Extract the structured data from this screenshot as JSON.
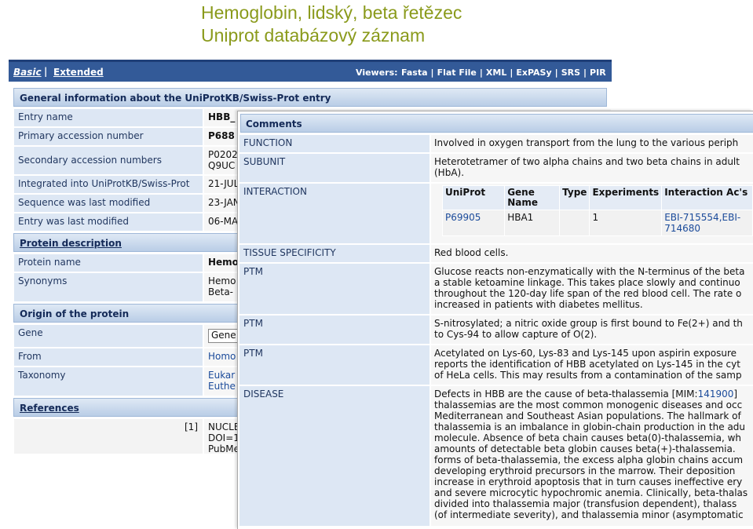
{
  "slide": {
    "title_line1": "Hemoglobin, lidský, beta řetězec",
    "title_line2": "Uniprot databázový záznam"
  },
  "nav": {
    "basic": "Basic",
    "separator": "|",
    "extended": "Extended",
    "viewers_label": "Viewers:",
    "viewers": [
      "Fasta",
      "Flat File",
      "XML",
      "ExPASy",
      "SRS",
      "PIR"
    ]
  },
  "general": {
    "heading": "General information about the UniProtKB/Swiss-Prot entry",
    "rows": [
      {
        "label": "Entry name",
        "value": "HBB_"
      },
      {
        "label": "Primary accession number",
        "value": "P688"
      },
      {
        "label": "Secondary accession numbers",
        "value_line1": "P0202",
        "value_line2": "Q9UC"
      },
      {
        "label": "Integrated into UniProtKB/Swiss-Prot",
        "value": "21-JUL"
      },
      {
        "label": "Sequence was last modified",
        "value": "23-JAN"
      },
      {
        "label": "Entry was last modified",
        "value": "06-MA"
      }
    ]
  },
  "protein": {
    "heading": "Protein description",
    "rows": [
      {
        "label": "Protein name",
        "value": "Hemo"
      },
      {
        "label": "Synonyms",
        "value_line1": "Hemo",
        "value_line2": "Beta-"
      }
    ]
  },
  "origin": {
    "heading": "Origin of the protein",
    "rows": [
      {
        "label": "Gene",
        "value": "Gene"
      },
      {
        "label": "From",
        "value": "Homo"
      },
      {
        "label": "Taxonomy",
        "value_line1": "Eukar",
        "value_line2": "Euthe"
      }
    ]
  },
  "references": {
    "heading": "References",
    "ref_number": "[1]",
    "ref_line1": "NUCLE",
    "ref_line2": "DOI=1",
    "ref_line3": "PubMe"
  },
  "comments": {
    "heading": "Comments",
    "function": {
      "label": "FUNCTION",
      "text": "Involved in oxygen transport from the lung to the various periph"
    },
    "subunit": {
      "label": "SUBUNIT",
      "line1": "Heterotetramer of two alpha chains and two beta chains in adult",
      "line2": "(HbA)."
    },
    "interaction": {
      "label": "INTERACTION",
      "headers": [
        "UniProt",
        "Gene Name",
        "Type",
        "Experiments",
        "Interaction Ac's"
      ],
      "header_gene_line1": "Gene",
      "header_gene_line2": "Name",
      "row": {
        "uniprot": "P69905",
        "gene": "HBA1",
        "type": "",
        "experiments": "1",
        "ac_line1": "EBI-715554,EBI-",
        "ac_line2": "714680"
      }
    },
    "tissue": {
      "label": "TISSUE SPECIFICITY",
      "text": "Red blood cells."
    },
    "ptm1": {
      "label": "PTM",
      "lines": [
        "Glucose reacts non-enzymatically with the N-terminus of the beta",
        "a stable ketoamine linkage. This takes place slowly and continuo",
        "throughout the 120-day life span of the red blood cell. The rate o",
        "increased in patients with diabetes mellitus."
      ]
    },
    "ptm2": {
      "label": "PTM",
      "lines": [
        "S-nitrosylated; a nitric oxide group is first bound to Fe(2+) and th",
        "to Cys-94 to allow capture of O(2)."
      ]
    },
    "ptm3": {
      "label": "PTM",
      "lines": [
        "Acetylated on Lys-60, Lys-83 and Lys-145 upon aspirin exposure",
        "reports the identification of HBB acetylated on Lys-145 in the cyt",
        "of HeLa cells. This may results from a contamination of the samp"
      ]
    },
    "disease": {
      "label": "DISEASE",
      "first_prefix": "Defects in HBB are the cause of beta-thalassemia [MIM:",
      "mim": "141900",
      "first_suffix": "]",
      "lines": [
        "thalassemias are the most common monogenic diseases and occ",
        "Mediterranean and Southeast Asian populations. The hallmark of",
        "thalassemia is an imbalance in globin-chain production in the adu",
        "molecule. Absence of beta chain causes beta(0)-thalassemia, wh",
        "amounts of detectable beta globin causes beta(+)-thalassemia.",
        "forms of beta-thalassemia, the excess alpha globin chains accum",
        "developing erythroid precursors in the marrow. Their deposition",
        "increase in erythroid apoptosis that in turn causes ineffective ery",
        "and severe microcytic hypochromic anemia. Clinically, beta-thalas",
        "divided into thalassemia major (transfusion dependent), thalass",
        "(of intermediate severity), and thalassemia minor (asymptomatic"
      ]
    }
  }
}
